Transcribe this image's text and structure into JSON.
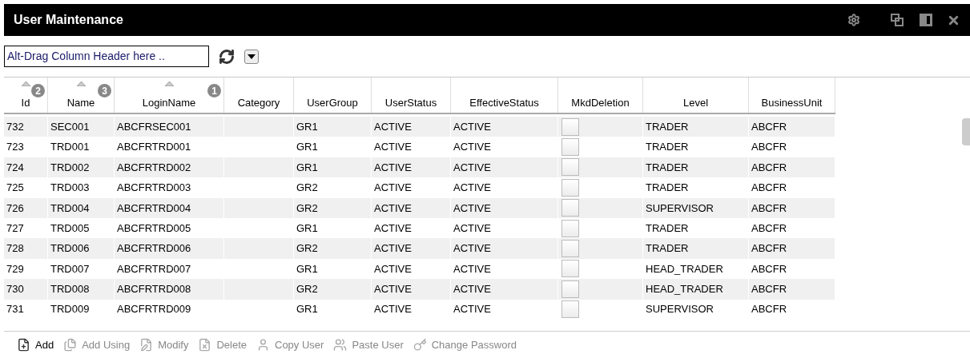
{
  "window": {
    "title": "User Maintenance"
  },
  "toolbar": {
    "group_field": {
      "value": "Alt-Drag Column Header here .."
    }
  },
  "table": {
    "columns": [
      {
        "label": "Id",
        "sorted": true,
        "sort_order": "2"
      },
      {
        "label": "Name",
        "sorted": true,
        "sort_order": "3"
      },
      {
        "label": "LoginName",
        "sorted": true,
        "sort_order": "1"
      },
      {
        "label": "Category",
        "sorted": false
      },
      {
        "label": "UserGroup",
        "sorted": false
      },
      {
        "label": "UserStatus",
        "sorted": false
      },
      {
        "label": "EffectiveStatus",
        "sorted": false
      },
      {
        "label": "MkdDeletion",
        "sorted": false
      },
      {
        "label": "Level",
        "sorted": false
      },
      {
        "label": "BusinessUnit",
        "sorted": false
      }
    ],
    "rows": [
      {
        "id": "732",
        "name": "SEC001",
        "login": "ABCFRSEC001",
        "category": "",
        "group": "GR1",
        "status": "ACTIVE",
        "effective": "ACTIVE",
        "marked_deletion": false,
        "level": "TRADER",
        "unit": "ABCFR"
      },
      {
        "id": "723",
        "name": "TRD001",
        "login": "ABCFRTRD001",
        "category": "",
        "group": "GR1",
        "status": "ACTIVE",
        "effective": "ACTIVE",
        "marked_deletion": false,
        "level": "TRADER",
        "unit": "ABCFR"
      },
      {
        "id": "724",
        "name": "TRD002",
        "login": "ABCFRTRD002",
        "category": "",
        "group": "GR1",
        "status": "ACTIVE",
        "effective": "ACTIVE",
        "marked_deletion": false,
        "level": "TRADER",
        "unit": "ABCFR"
      },
      {
        "id": "725",
        "name": "TRD003",
        "login": "ABCFRTRD003",
        "category": "",
        "group": "GR2",
        "status": "ACTIVE",
        "effective": "ACTIVE",
        "marked_deletion": false,
        "level": "TRADER",
        "unit": "ABCFR"
      },
      {
        "id": "726",
        "name": "TRD004",
        "login": "ABCFRTRD004",
        "category": "",
        "group": "GR2",
        "status": "ACTIVE",
        "effective": "ACTIVE",
        "marked_deletion": false,
        "level": "SUPERVISOR",
        "unit": "ABCFR"
      },
      {
        "id": "727",
        "name": "TRD005",
        "login": "ABCFRTRD005",
        "category": "",
        "group": "GR1",
        "status": "ACTIVE",
        "effective": "ACTIVE",
        "marked_deletion": false,
        "level": "TRADER",
        "unit": "ABCFR"
      },
      {
        "id": "728",
        "name": "TRD006",
        "login": "ABCFRTRD006",
        "category": "",
        "group": "GR2",
        "status": "ACTIVE",
        "effective": "ACTIVE",
        "marked_deletion": false,
        "level": "TRADER",
        "unit": "ABCFR"
      },
      {
        "id": "729",
        "name": "TRD007",
        "login": "ABCFRTRD007",
        "category": "",
        "group": "GR1",
        "status": "ACTIVE",
        "effective": "ACTIVE",
        "marked_deletion": false,
        "level": "HEAD_TRADER",
        "unit": "ABCFR"
      },
      {
        "id": "730",
        "name": "TRD008",
        "login": "ABCFRTRD008",
        "category": "",
        "group": "GR2",
        "status": "ACTIVE",
        "effective": "ACTIVE",
        "marked_deletion": false,
        "level": "HEAD_TRADER",
        "unit": "ABCFR"
      },
      {
        "id": "731",
        "name": "TRD009",
        "login": "ABCFRTRD009",
        "category": "",
        "group": "GR1",
        "status": "ACTIVE",
        "effective": "ACTIVE",
        "marked_deletion": false,
        "level": "SUPERVISOR",
        "unit": "ABCFR"
      }
    ]
  },
  "actions": [
    {
      "kind": "add",
      "label": "Add",
      "disabled": false
    },
    {
      "kind": "add_using",
      "label": "Add Using",
      "disabled": true
    },
    {
      "kind": "modify",
      "label": "Modify",
      "disabled": true
    },
    {
      "kind": "delete",
      "label": "Delete",
      "disabled": true
    },
    {
      "kind": "copy_user",
      "label": "Copy User",
      "disabled": true
    },
    {
      "kind": "paste_user",
      "label": "Paste User",
      "disabled": true
    },
    {
      "kind": "change_password",
      "label": "Change Password",
      "disabled": true
    }
  ]
}
